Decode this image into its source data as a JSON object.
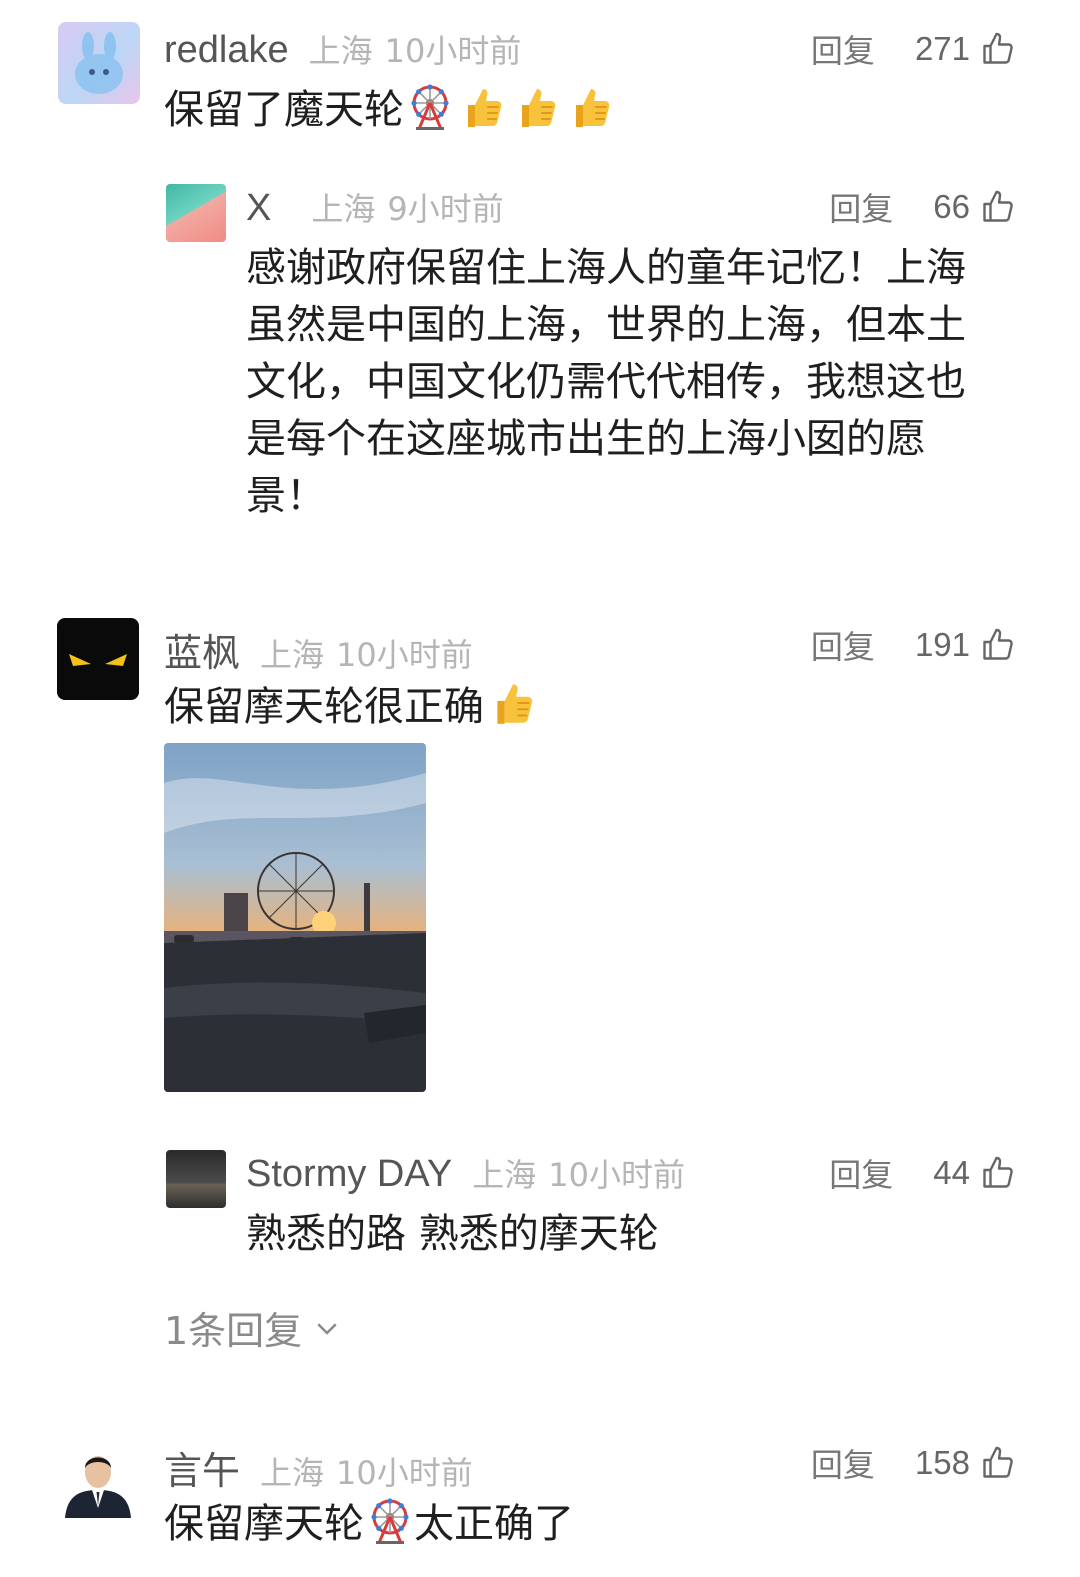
{
  "comments": [
    {
      "author": "redlake",
      "location": "上海",
      "time": "10小时前",
      "reply_label": "回复",
      "likes": "271",
      "text": "保留了魔天轮",
      "emojis": [
        "ferris-wheel",
        "thumbs-up",
        "thumbs-up",
        "thumbs-up"
      ],
      "replies": [
        {
          "author": "X",
          "location": "上海",
          "time": "9小时前",
          "reply_label": "回复",
          "likes": "66",
          "text": "感谢政府保留住上海人的童年记忆！上海虽然是中国的上海，世界的上海，但本土文化，中国文化仍需代代相传，我想这也是每个在这座城市出生的上海小囡的愿景！"
        }
      ]
    },
    {
      "author": "蓝枫",
      "location": "上海",
      "time": "10小时前",
      "reply_label": "回复",
      "likes": "191",
      "text": "保留摩天轮很正确",
      "emojis": [
        "thumbs-up"
      ],
      "has_photo": true,
      "replies": [
        {
          "author": "Stormy DAY",
          "location": "上海",
          "time": "10小时前",
          "reply_label": "回复",
          "likes": "44",
          "text": "熟悉的路 熟悉的摩天轮"
        }
      ],
      "more_replies_label": "1条回复"
    },
    {
      "author": "言午",
      "location": "上海",
      "time": "10小时前",
      "reply_label": "回复",
      "likes": "158",
      "text_before": "保留摩天轮",
      "text_after": "太正确了",
      "emojis": [
        "ferris-wheel"
      ]
    }
  ],
  "colors": {
    "author": "#555555",
    "meta": "#b5b5b5",
    "text": "#1f1f1f",
    "thumb": "#f5b72a"
  }
}
